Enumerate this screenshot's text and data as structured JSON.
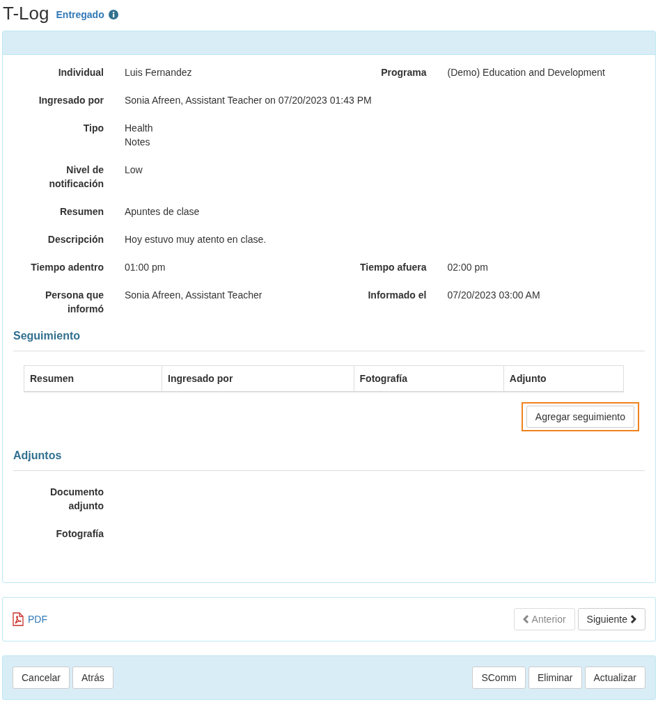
{
  "title": "T-Log",
  "status": {
    "label": "Entregado"
  },
  "details": [
    {
      "cells": [
        {
          "label": "Individual",
          "lines": [
            "Luis Fernandez"
          ]
        },
        {
          "label": "Programa",
          "lines": [
            "(Demo) Education and Development"
          ]
        }
      ]
    },
    {
      "cells": [
        {
          "label": "Ingresado por",
          "lines": [
            "Sonia Afreen, Assistant Teacher on 07/20/2023 01:43 PM"
          ]
        }
      ]
    },
    {
      "cells": [
        {
          "label": "Tipo",
          "lines": [
            "Health",
            "Notes"
          ]
        }
      ]
    },
    {
      "cells": [
        {
          "label": "Nivel de notificación",
          "lines": [
            "Low"
          ]
        }
      ]
    },
    {
      "cells": [
        {
          "label": "Resumen",
          "lines": [
            "Apuntes de clase"
          ]
        }
      ]
    },
    {
      "cells": [
        {
          "label": "Descripción",
          "lines": [
            "Hoy estuvo muy atento en clase."
          ]
        }
      ]
    },
    {
      "cells": [
        {
          "label": "Tiempo adentro",
          "lines": [
            "01:00 pm"
          ]
        },
        {
          "label": "Tiempo afuera",
          "lines": [
            "02:00 pm"
          ]
        }
      ]
    },
    {
      "cells": [
        {
          "label": "Persona que informó",
          "lines": [
            "Sonia Afreen, Assistant Teacher"
          ]
        },
        {
          "label": "Informado el",
          "lines": [
            "07/20/2023 03:00 AM"
          ]
        }
      ]
    }
  ],
  "followup": {
    "heading": "Seguimiento",
    "columns": [
      "Resumen",
      "Ingresado por",
      "Fotografía",
      "Adjunto"
    ],
    "button": {
      "label": "Agregar seguimiento",
      "highlighted": true
    }
  },
  "attachments": {
    "heading": "Adjuntos",
    "fields": [
      {
        "label": "Documento adjunto"
      },
      {
        "label": "Fotografía"
      }
    ]
  },
  "pager": {
    "pdf": "PDF",
    "buttons": [
      {
        "kind": "prev",
        "label": "Anterior",
        "disabled": true
      },
      {
        "kind": "next",
        "label": "Siguiente",
        "disabled": false
      }
    ]
  },
  "actions": {
    "left": [
      "Cancelar",
      "Atrás"
    ],
    "right": [
      "SComm",
      "Eliminar",
      "Actualizar"
    ]
  }
}
